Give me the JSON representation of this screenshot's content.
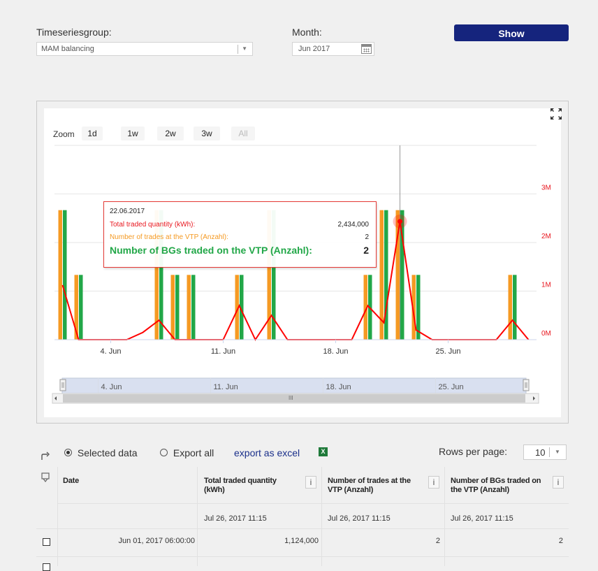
{
  "form": {
    "timeseries_label": "Timeseriesgroup:",
    "timeseries_value": "MAM balancing",
    "month_label": "Month:",
    "month_value": "Jun 2017",
    "show_label": "Show"
  },
  "zoom": {
    "label": "Zoom",
    "buttons": [
      "1d",
      "1w",
      "2w",
      "3w",
      "All"
    ]
  },
  "navigator_labels": [
    "4. Jun",
    "11. Jun",
    "18. Jun",
    "25. Jun"
  ],
  "scrollbar_grip": "III",
  "tooltip": {
    "date": "22.06.2017",
    "rows": [
      {
        "label": "Total traded quantity (kWh):",
        "value": "2,434,000"
      },
      {
        "label": "Number of trades at the VTP (Anzahl):",
        "value": "2"
      },
      {
        "label": "Number of BGs traded on the VTP (Anzahl):",
        "value": "2"
      }
    ]
  },
  "chart_data": {
    "type": "bar",
    "x_tick_labels": [
      "4. Jun",
      "11. Jun",
      "18. Jun",
      "25. Jun"
    ],
    "y_right_ticks": [
      "0M",
      "1M",
      "2M",
      "3M"
    ],
    "y_right_range": [
      0,
      4000000
    ],
    "y_left_range": [
      0,
      3
    ],
    "days": [
      1,
      2,
      3,
      4,
      5,
      6,
      7,
      8,
      9,
      10,
      11,
      12,
      13,
      14,
      15,
      16,
      17,
      18,
      19,
      20,
      21,
      22,
      23,
      24,
      25,
      26,
      27,
      28,
      29,
      30
    ],
    "series": [
      {
        "name": "Number of trades at the VTP (Anzahl)",
        "type": "bar",
        "color": "#f59a23",
        "values": [
          2,
          1,
          0,
          0,
          0,
          0,
          2,
          1,
          1,
          0,
          0,
          1,
          0,
          2,
          0,
          0,
          0,
          0,
          0,
          1,
          2,
          2,
          1,
          0,
          0,
          0,
          0,
          0,
          1,
          0
        ]
      },
      {
        "name": "Number of BGs traded on the VTP (Anzahl)",
        "type": "bar",
        "color": "#22a748",
        "values": [
          2,
          1,
          0,
          0,
          0,
          0,
          2,
          1,
          1,
          0,
          0,
          1,
          0,
          2,
          0,
          0,
          0,
          0,
          0,
          1,
          2,
          2,
          1,
          0,
          0,
          0,
          0,
          0,
          1,
          0
        ]
      },
      {
        "name": "Total traded quantity (kWh)",
        "type": "line",
        "color": "#ff0000",
        "values": [
          1124000,
          0,
          0,
          0,
          0,
          150000,
          400000,
          0,
          0,
          0,
          0,
          700000,
          0,
          500000,
          0,
          0,
          0,
          0,
          0,
          700000,
          350000,
          2434000,
          200000,
          0,
          0,
          0,
          0,
          0,
          400000,
          0
        ]
      }
    ],
    "highlight_index": 21,
    "grid": true
  },
  "export": {
    "selected_label": "Selected data",
    "all_label": "Export all",
    "excel_label": "export as excel",
    "rows_label": "Rows per page:",
    "rows_value": "10"
  },
  "table": {
    "headers": [
      "Date",
      "Total traded quantity (kWh)",
      "Number of trades at the VTP (Anzahl)",
      "Number of BGs traded on the VTP (Anzahl)"
    ],
    "subheader": [
      "Jul 26, 2017 11:15",
      "Jul 26, 2017 11:15",
      "Jul 26, 2017 11:15"
    ],
    "rows": [
      {
        "date": "Jun 01, 2017 06:00:00",
        "quantity": "1,124,000",
        "trades": "2",
        "bgs": "2"
      }
    ]
  }
}
